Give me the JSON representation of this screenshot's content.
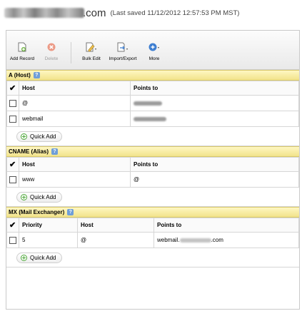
{
  "header": {
    "domain_suffix": ".com",
    "last_saved": "(Last saved 11/12/2012 12:57:53 PM MST)"
  },
  "toolbar": {
    "add_record": "Add Record",
    "delete": "Delete",
    "bulk_edit": "Bulk Edit",
    "import_export": "Import/Export",
    "more": "More"
  },
  "sections": {
    "a": {
      "title": "A (Host)",
      "col_host": "Host",
      "col_points": "Points to",
      "rows": [
        {
          "host": "@"
        },
        {
          "host": "webmail"
        }
      ]
    },
    "cname": {
      "title": "CNAME (Alias)",
      "col_host": "Host",
      "col_points": "Points to",
      "rows": [
        {
          "host": "www",
          "points_to": "@"
        }
      ]
    },
    "mx": {
      "title": "MX (Mail Exchanger)",
      "col_priority": "Priority",
      "col_host": "Host",
      "col_points": "Points to",
      "rows": [
        {
          "priority": "5",
          "host": "@",
          "points_prefix": "webmail.",
          "points_suffix": ".com"
        }
      ]
    }
  },
  "quick_add_label": "Quick Add",
  "colors": {
    "section_header": "#f2e38b",
    "accent_blue": "#3f7fd1",
    "delete_red": "#e07a5f"
  }
}
